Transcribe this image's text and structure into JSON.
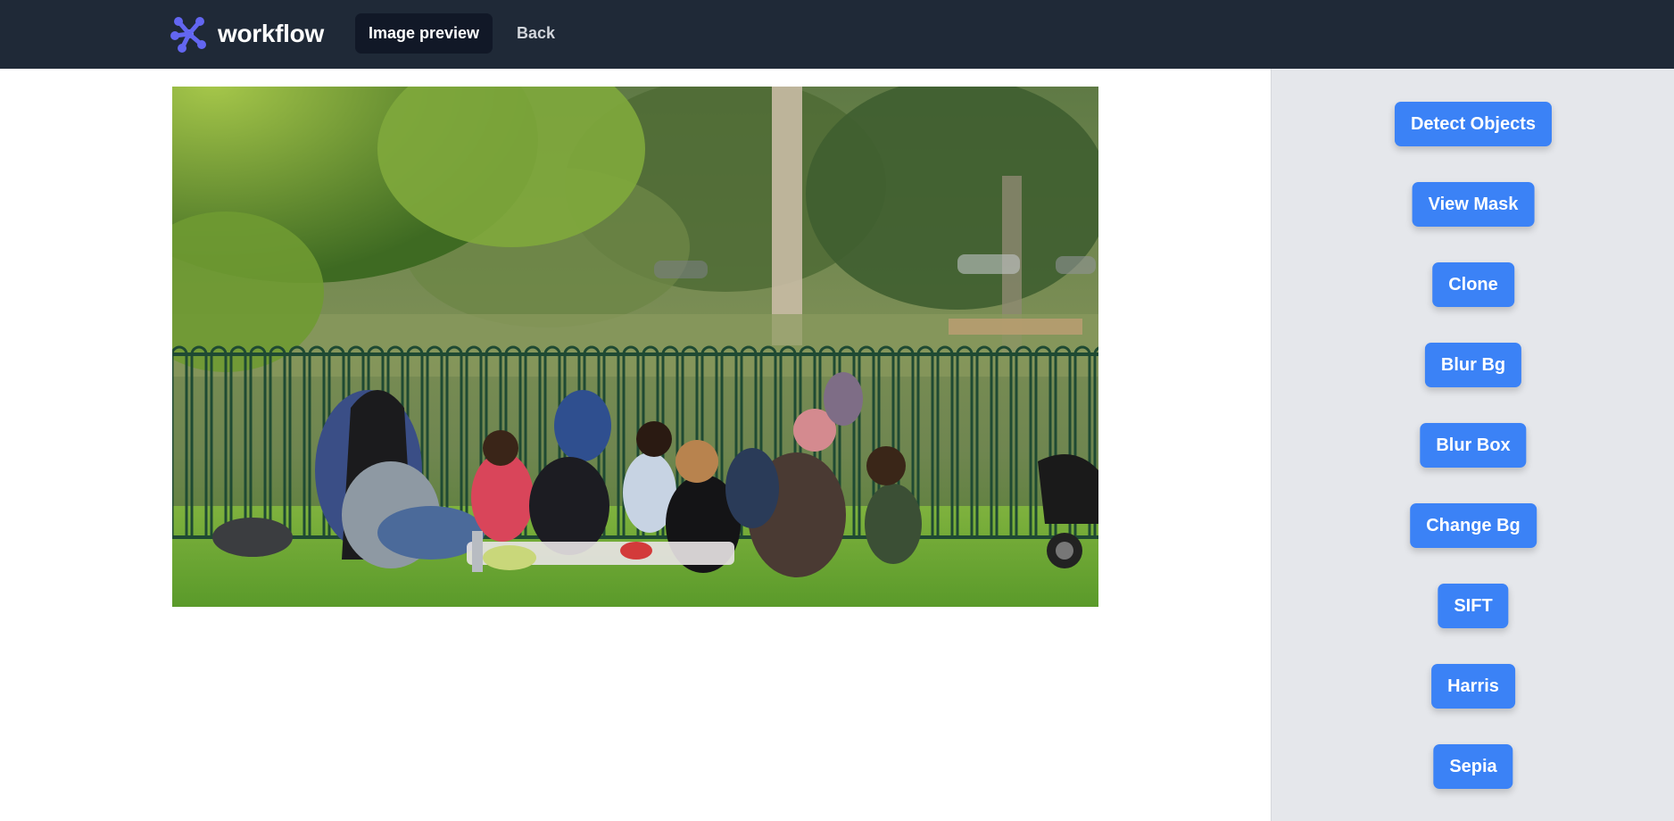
{
  "app": {
    "brand_name": "workflow",
    "logo_icon": "workflow-logo-icon",
    "accent_color": "#3b82f6",
    "navbar_color": "#1f2937"
  },
  "nav": {
    "active_tab": "Image preview",
    "back_link": "Back"
  },
  "preview": {
    "image_icon": "photo-park-picnic"
  },
  "sidebar": {
    "actions": [
      {
        "label": "Detect Objects"
      },
      {
        "label": "View Mask"
      },
      {
        "label": "Clone"
      },
      {
        "label": "Blur Bg"
      },
      {
        "label": "Blur Box"
      },
      {
        "label": "Change Bg"
      },
      {
        "label": "SIFT"
      },
      {
        "label": "Harris"
      },
      {
        "label": "Sepia"
      }
    ]
  }
}
